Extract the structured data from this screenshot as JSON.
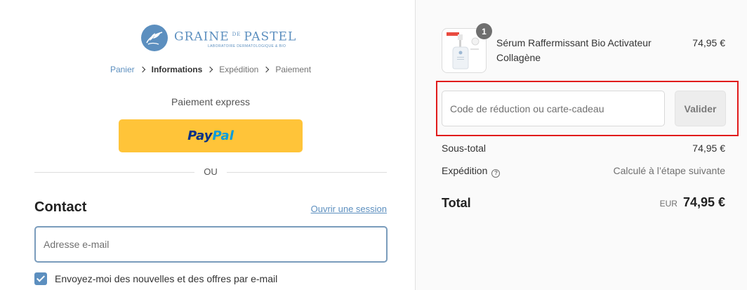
{
  "brand": {
    "name_left": "GRAINE",
    "name_small": "DE",
    "name_right": "PASTEL",
    "tagline": "LABORATOIRE DERMATOLOGIQUE & BIO",
    "color": "#5c8fbf"
  },
  "breadcrumb": {
    "items": [
      "Panier",
      "Informations",
      "Expédition",
      "Paiement"
    ],
    "current_index": 1
  },
  "express": {
    "title": "Paiement express",
    "paypal_a": "Pay",
    "paypal_b": "Pal",
    "button_color": "#ffc439"
  },
  "divider_text": "OU",
  "contact": {
    "title": "Contact",
    "login_link": "Ouvrir une session",
    "email_placeholder": "Adresse e-mail",
    "newsletter_label": "Envoyez-moi des nouvelles et des offres par e-mail",
    "newsletter_checked": true
  },
  "cart": {
    "item": {
      "name": "Sérum Raffermissant Bio Activateur Collagène",
      "price": "74,95 €",
      "quantity": "1",
      "image_icon": "serum-bottle-thumbnail"
    },
    "discount": {
      "placeholder": "Code de réduction ou carte-cadeau",
      "apply_label": "Valider"
    },
    "subtotal_label": "Sous-total",
    "subtotal_value": "74,95 €",
    "shipping_label": "Expédition",
    "shipping_value": "Calculé à l’étape suivante",
    "total_label": "Total",
    "total_currency": "EUR",
    "total_value": "74,95 €"
  },
  "colors": {
    "highlight": "#e11b1b",
    "accent": "#5c8fbf"
  }
}
